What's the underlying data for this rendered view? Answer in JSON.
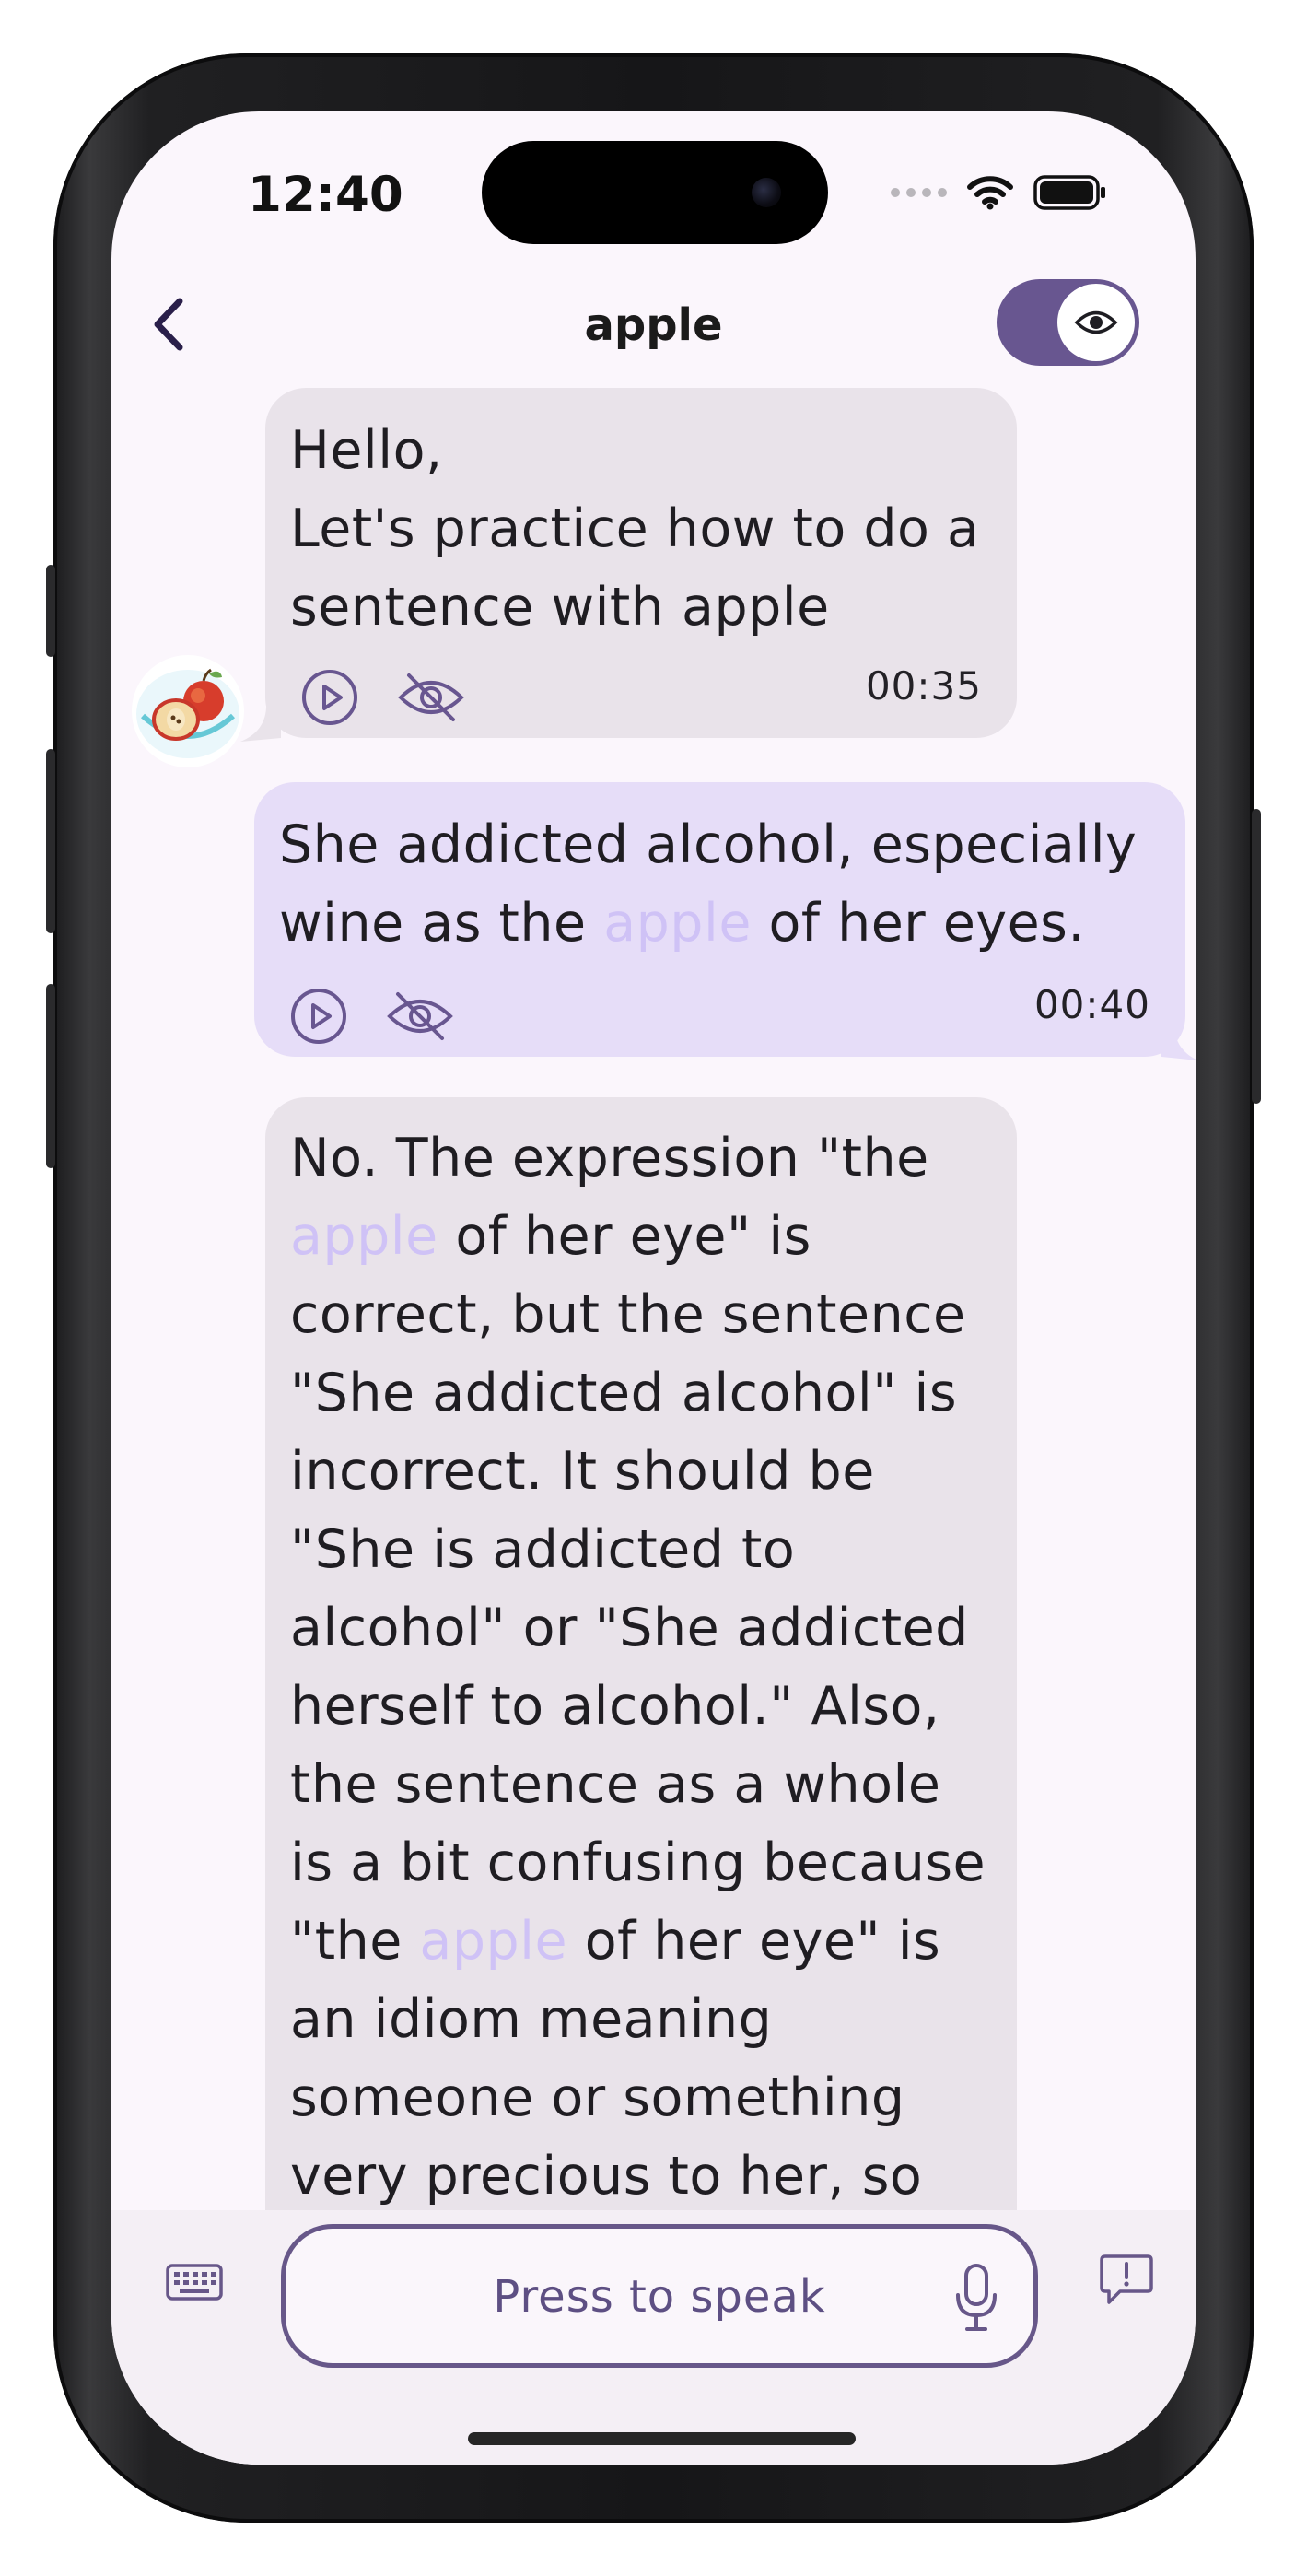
{
  "status_bar": {
    "time": "12:40"
  },
  "header": {
    "title": "apple",
    "eye_toggle_on": true
  },
  "messages": [
    {
      "role": "bot",
      "avatar": "apple-illustration",
      "segments": [
        {
          "t": "Hello,\nLet's practice how to do a sentence with apple",
          "hl": false
        }
      ],
      "timestamp": "00:35"
    },
    {
      "role": "user",
      "segments": [
        {
          "t": "She addicted alcohol, especially wine as the ",
          "hl": false
        },
        {
          "t": "apple",
          "hl": true
        },
        {
          "t": " of her eyes.",
          "hl": false
        }
      ],
      "timestamp": "00:40"
    },
    {
      "role": "bot",
      "segments": [
        {
          "t": "No. The expression \"the ",
          "hl": false
        },
        {
          "t": "apple",
          "hl": true
        },
        {
          "t": " of her eye\" is correct, but the sentence \"She addicted alcohol\" is incorrect. It should be \"She is addicted to alcohol\" or \"She addicted herself to alcohol.\" Also, the sentence as a whole is a bit confusing because \"the ",
          "hl": false
        },
        {
          "t": "apple",
          "hl": true
        },
        {
          "t": " of her eye\" is an idiom meaning someone or something very precious to her, so the sentence should clearly",
          "hl": false
        }
      ],
      "timestamp": ""
    }
  ],
  "input": {
    "speak_label": "Press to speak"
  },
  "colors": {
    "accent": "#685690",
    "bot_bubble": "#e9e3ea",
    "user_bubble": "#e6ddf8",
    "highlight": "#cfc2f6",
    "screen_bg": "#fbf6fc"
  },
  "icons": [
    "back-chevron-icon",
    "eye-icon",
    "play-icon",
    "eye-slash-icon",
    "keyboard-icon",
    "microphone-icon",
    "feedback-icon",
    "wifi-icon",
    "battery-icon"
  ]
}
